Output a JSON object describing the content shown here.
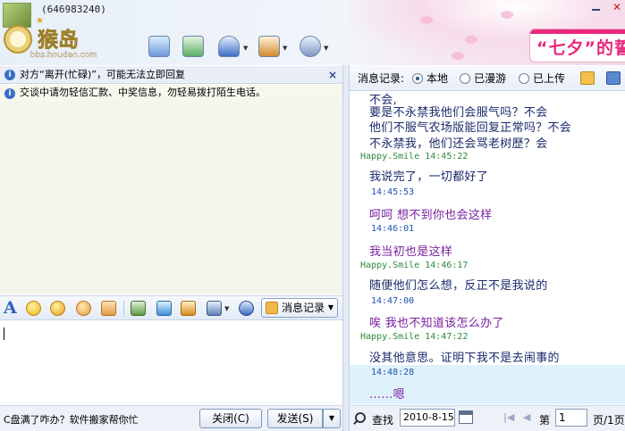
{
  "header": {
    "user_id": "(646983240)",
    "logo_text": "猴岛",
    "logo_url": "bbs.houdao.com",
    "banner_text": "“七夕”的誓",
    "close_glyph": "✕"
  },
  "notices": {
    "status": "对方“离开(忙碌)”，可能无法立即回复",
    "close": "×",
    "safety": "交谈中请勿轻信汇款、中奖信息，勿轻易拨打陌生电话。"
  },
  "input_toolbar": {
    "font_glyph": "A",
    "msglog_label": "消息记录",
    "msglog_arrow": "▼"
  },
  "bottom_left": {
    "ad_text": "C盘满了咋办？软件搬家帮你忙",
    "close_label": "关闭(C)",
    "send_label": "发送(S)",
    "send_arrow": "▼"
  },
  "history_header": {
    "label": "消息记录:",
    "options": [
      "本地",
      "已漫游",
      "已上传"
    ],
    "selected": "本地"
  },
  "history": [
    {
      "kind": "line",
      "text": "不会,",
      "color": "dark"
    },
    {
      "kind": "line",
      "text": "要是不永禁我他们会服气吗？不会",
      "color": "dark"
    },
    {
      "kind": "line",
      "text": "他们不服气农场版能回复正常吗？不会",
      "color": "dark"
    },
    {
      "kind": "line",
      "text": "不永禁我，他们还会骂老树歷？会",
      "color": "dark"
    },
    {
      "kind": "sender",
      "text": "Happy.Smile 14:45:22"
    },
    {
      "kind": "line",
      "text": "我说完了，一切都好了",
      "color": "dark"
    },
    {
      "kind": "time",
      "text": "14:45:53"
    },
    {
      "kind": "line",
      "text": "呵呵 想不到你也会这样",
      "color": "purple"
    },
    {
      "kind": "time",
      "text": "14:46:01"
    },
    {
      "kind": "line",
      "text": "我当初也是这样",
      "color": "purple"
    },
    {
      "kind": "sender",
      "text": "Happy.Smile 14:46:17"
    },
    {
      "kind": "line",
      "text": "随便他们怎么想，反正不是我说的",
      "color": "dark"
    },
    {
      "kind": "time",
      "text": "14:47:00"
    },
    {
      "kind": "line",
      "text": "唉 我也不知道该怎么办了",
      "color": "purple"
    },
    {
      "kind": "sender",
      "text": "Happy.Smile 14:47:22"
    },
    {
      "kind": "line",
      "text": "没其他意思。证明下我不是去闹事的",
      "color": "dark"
    },
    {
      "kind": "time",
      "text": "14:48:28"
    },
    {
      "kind": "line",
      "text": "……嗯",
      "color": "purple"
    }
  ],
  "history_footer": {
    "find_label": "查找",
    "date_value": "2010-8-15",
    "first_glyph": "|◀",
    "prev_glyph": "◀",
    "page_prefix": "第",
    "page_value": "1",
    "page_total": "页/1页"
  },
  "colors": {
    "accent": "#3a6fc6",
    "sender_green": "#2c8a3e",
    "time_blue": "#1d52b0",
    "msg_dark": "#1a2a6c",
    "msg_purple": "#7a1f9e",
    "banner_pink": "#e8287c"
  }
}
